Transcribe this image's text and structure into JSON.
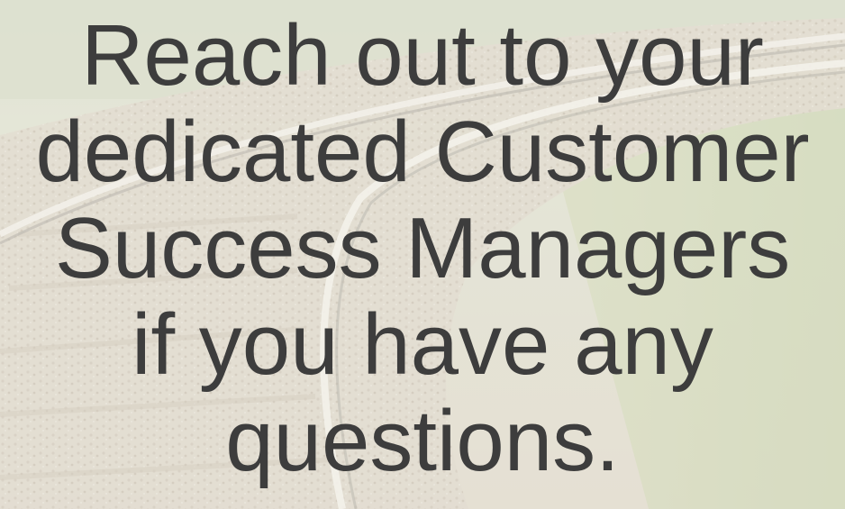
{
  "slide": {
    "message_lines": [
      "Reach out to your",
      "dedicated Customer",
      "Success Managers",
      "if you have any",
      "questions."
    ],
    "background": {
      "description_icon": "railway-track-photo",
      "text_color": "#3d3d3d"
    }
  }
}
